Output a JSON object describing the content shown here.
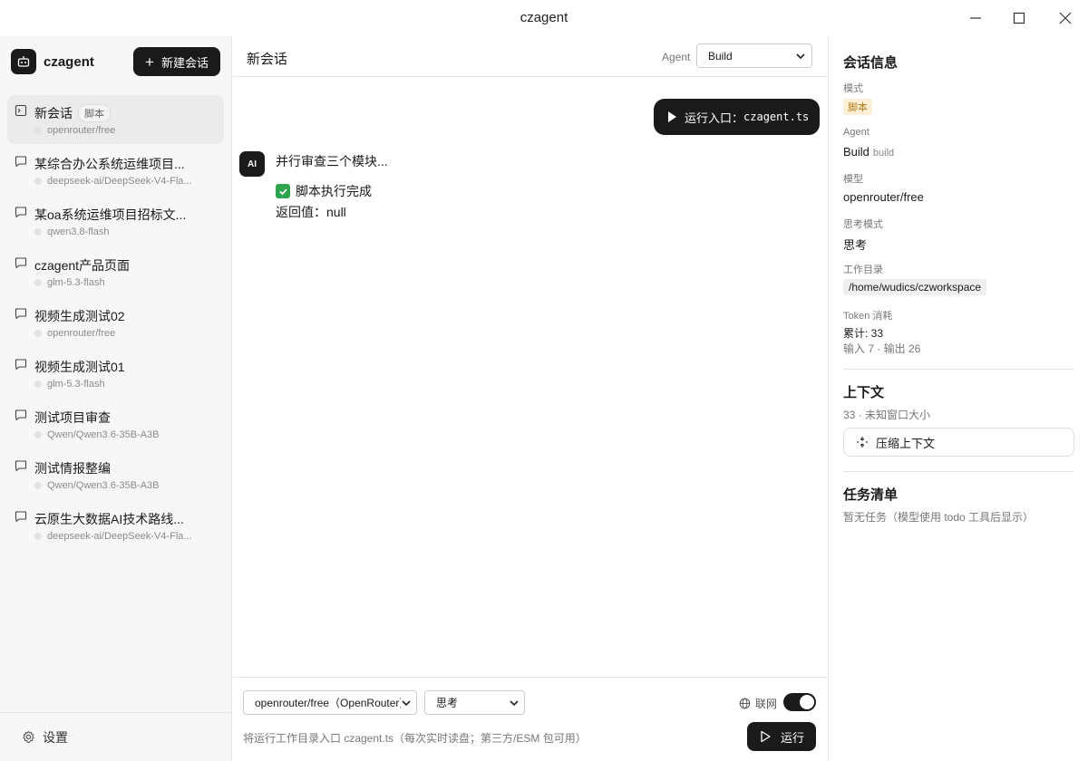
{
  "window": {
    "title": "czagent"
  },
  "sidebar": {
    "brand": "czagent",
    "new_chat_label": "新建会话",
    "conversations": [
      {
        "title": "新会话",
        "badge": "脚本",
        "subtitle": "openrouter/free",
        "active": true
      },
      {
        "title": "某综合办公系统运维项目...",
        "subtitle": "deepseek-ai/DeepSeek-V4-Fla..."
      },
      {
        "title": "某oa系统运维项目招标文...",
        "subtitle": "qwen3.8-flash"
      },
      {
        "title": "czagent产品页面",
        "subtitle": "glm-5.3-flash"
      },
      {
        "title": "视频生成测试02",
        "subtitle": "openrouter/free"
      },
      {
        "title": "视频生成测试01",
        "subtitle": "glm-5.3-flash"
      },
      {
        "title": "测试项目审查",
        "subtitle": "Qwen/Qwen3.6-35B-A3B"
      },
      {
        "title": "测试情报整编",
        "subtitle": "Qwen/Qwen3.6-35B-A3B"
      },
      {
        "title": "云原生大数据AI技术路线...",
        "subtitle": "deepseek-ai/DeepSeek-V4-Fla..."
      }
    ],
    "settings_label": "设置"
  },
  "main": {
    "title": "新会话",
    "agent_label": "Agent",
    "agent_value": "Build",
    "run_prefix": "运行入口：",
    "run_command": "czagent.ts",
    "ai_avatar": "AI",
    "ai_heading": "并行审查三个模块...",
    "ai_status": "脚本执行完成",
    "ai_return": "返回值：null"
  },
  "composer": {
    "model_value": "openrouter/free（OpenRouter）",
    "think_value": "思考",
    "net_label": "联网",
    "net_enabled": true,
    "hint": "将运行工作目录入口 czagent.ts（每次实时读盘；第三方/ESM 包可用）",
    "run_label": "运行"
  },
  "info": {
    "heading": "会话信息",
    "mode_label": "模式",
    "mode_value": "脚本",
    "agent_label": "Agent",
    "agent_value": "Build",
    "agent_sub": "build",
    "model_label": "模型",
    "model_value": "openrouter/free",
    "think_label": "思考模式",
    "think_value": "思考",
    "workdir_label": "工作目录",
    "workdir_value": "/home/wudics/czworkspace",
    "token_label": "Token 消耗",
    "token_total": "累计: 33",
    "token_detail": "输入 7 · 输出 26",
    "context_heading": "上下文",
    "context_detail": "33 · 未知窗口大小",
    "compress_label": "压缩上下文",
    "tasks_heading": "任务清单",
    "tasks_empty": "暂无任务（模型使用 todo 工具后显示）"
  }
}
